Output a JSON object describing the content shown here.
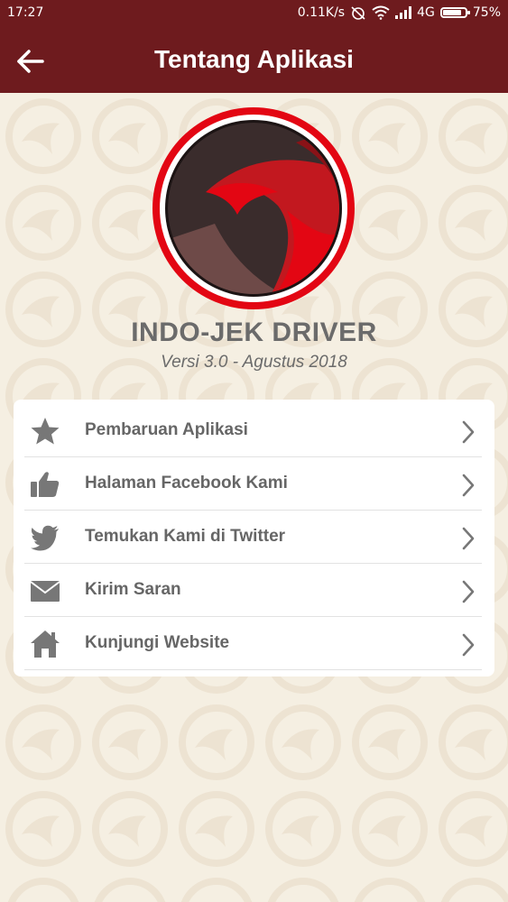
{
  "status_bar": {
    "time": "17:27",
    "network_speed": "0.11K/s",
    "network_type": "4G",
    "battery": "75%",
    "battery_level": 0.75,
    "icons": [
      "alarm-off-icon",
      "wifi-icon",
      "signal-icon",
      "battery-icon"
    ]
  },
  "app_bar": {
    "title": "Tentang Aplikasi",
    "back_icon": "arrow-left-icon"
  },
  "app_info": {
    "name": "INDO-JEK DRIVER",
    "version": "Versi 3.0 - Agustus 2018"
  },
  "menu": {
    "items": [
      {
        "label": "Pembaruan Aplikasi",
        "icon": "star-icon"
      },
      {
        "label": "Halaman Facebook Kami",
        "icon": "thumbs-up-icon"
      },
      {
        "label": "Temukan Kami di Twitter",
        "icon": "twitter-icon"
      },
      {
        "label": "Kirim Saran",
        "icon": "envelope-icon"
      },
      {
        "label": "Kunjungi Website",
        "icon": "home-icon"
      }
    ]
  },
  "colors": {
    "primary": "#6e1b1e",
    "background": "#f5efe2",
    "accent_red": "#e30613",
    "logo_dark": "#3a2c2c",
    "text_gray": "#6b6b6b",
    "icon_gray": "#777777"
  }
}
